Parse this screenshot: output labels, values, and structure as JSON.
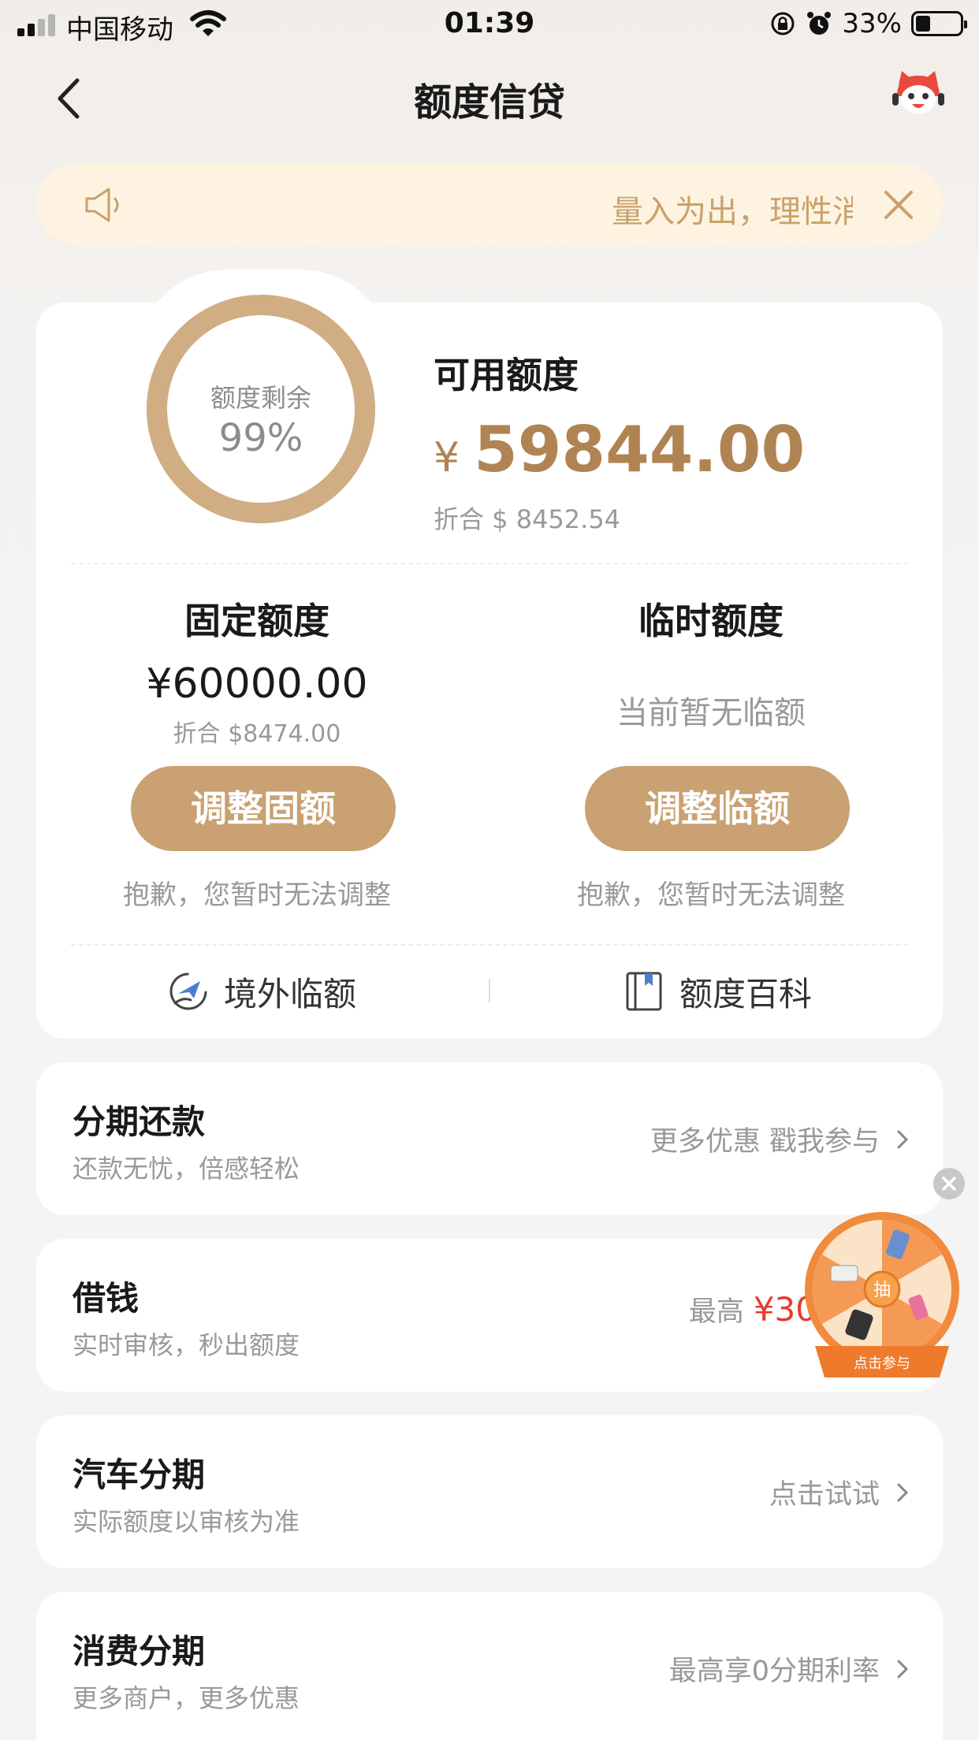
{
  "status_bar": {
    "carrier": "中国移动",
    "time": "01:39",
    "battery_percent": "33%"
  },
  "nav": {
    "title": "额度信贷"
  },
  "notice": {
    "text": "量入为出，理性消"
  },
  "credit": {
    "ring_label": "额度剩余",
    "ring_value": "99%",
    "ring_fraction": 0.99,
    "available_label": "可用额度",
    "currency_symbol": "¥",
    "available_amount": "59844.00",
    "available_converted": "折合 $ 8452.54"
  },
  "fixed": {
    "title": "固定额度",
    "amount": "¥60000.00",
    "converted": "折合 $8474.00",
    "button": "调整固额",
    "note": "抱歉，您暂时无法调整"
  },
  "temporary": {
    "title": "临时额度",
    "status": "当前暂无临额",
    "button": "调整临额",
    "note": "抱歉，您暂时无法调整"
  },
  "links": {
    "overseas": "境外临额",
    "encyclopedia": "额度百科"
  },
  "list": [
    {
      "title": "分期还款",
      "subtitle": "还款无忧，倍感轻松",
      "right": "更多优惠 戳我参与"
    },
    {
      "title": "借钱",
      "subtitle": "实时审核，秒出额度",
      "right_prefix": "最高",
      "right_value": "¥30"
    },
    {
      "title": "汽车分期",
      "subtitle": "实际额度以审核为准",
      "right": "点击试试"
    },
    {
      "title": "消费分期",
      "subtitle": "更多商户，更多优惠",
      "right": "最高享0分期利率"
    }
  ],
  "wheel": {
    "center_label": "抽",
    "button_label": "点击参与"
  },
  "colors": {
    "accent": "#b08452",
    "button": "#c9a172",
    "ring_track": "#e3cdb3",
    "ring_fill": "#d1ad83",
    "notice_bg": "#fdf3e0",
    "red": "#e8392e"
  }
}
